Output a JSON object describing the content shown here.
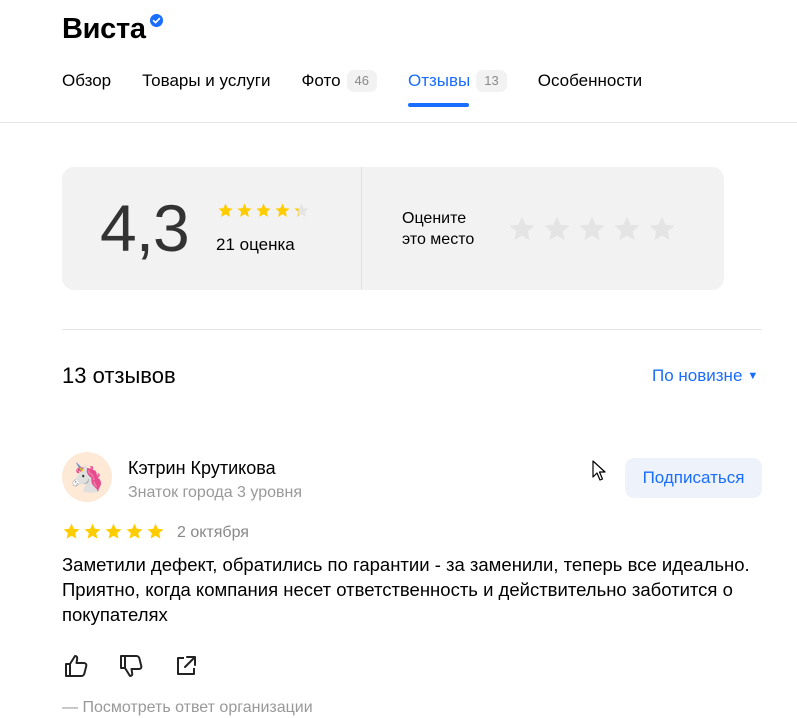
{
  "org": {
    "name": "Виста",
    "verified_icon": "verified-badge-icon"
  },
  "tabs": [
    {
      "label": "Обзор",
      "count": ""
    },
    {
      "label": "Товары и услуги",
      "count": ""
    },
    {
      "label": "Фото",
      "count": "46"
    },
    {
      "label": "Отзывы",
      "count": "13",
      "active": true
    },
    {
      "label": "Особенности",
      "count": ""
    }
  ],
  "rating": {
    "value": "4,3",
    "stars": 4.3,
    "count_label": "21 оценка",
    "rate_prompt_line1": "Оцените",
    "rate_prompt_line2": "это место"
  },
  "reviews": {
    "heading": "13 отзывов",
    "sort_label": "По новизне",
    "sort_caret": "▼"
  },
  "review": {
    "avatar_emoji": "🦄",
    "author": "Кэтрин Крутикова",
    "level": "Знаток города 3 уровня",
    "subscribe_label": "Подписаться",
    "stars": 5,
    "date": "2 октября",
    "text": "Заметили дефект, обратились по гарантии - за заменили, теперь все идеально. Приятно, когда компания несет ответственность и действительно заботится о покупателях",
    "org_reply_label": "—  Посмотреть ответ организации"
  },
  "colors": {
    "accent": "#196dff",
    "star_gold": "#ffcc00",
    "star_empty": "#e4e4e4",
    "muted_text": "#999999"
  }
}
